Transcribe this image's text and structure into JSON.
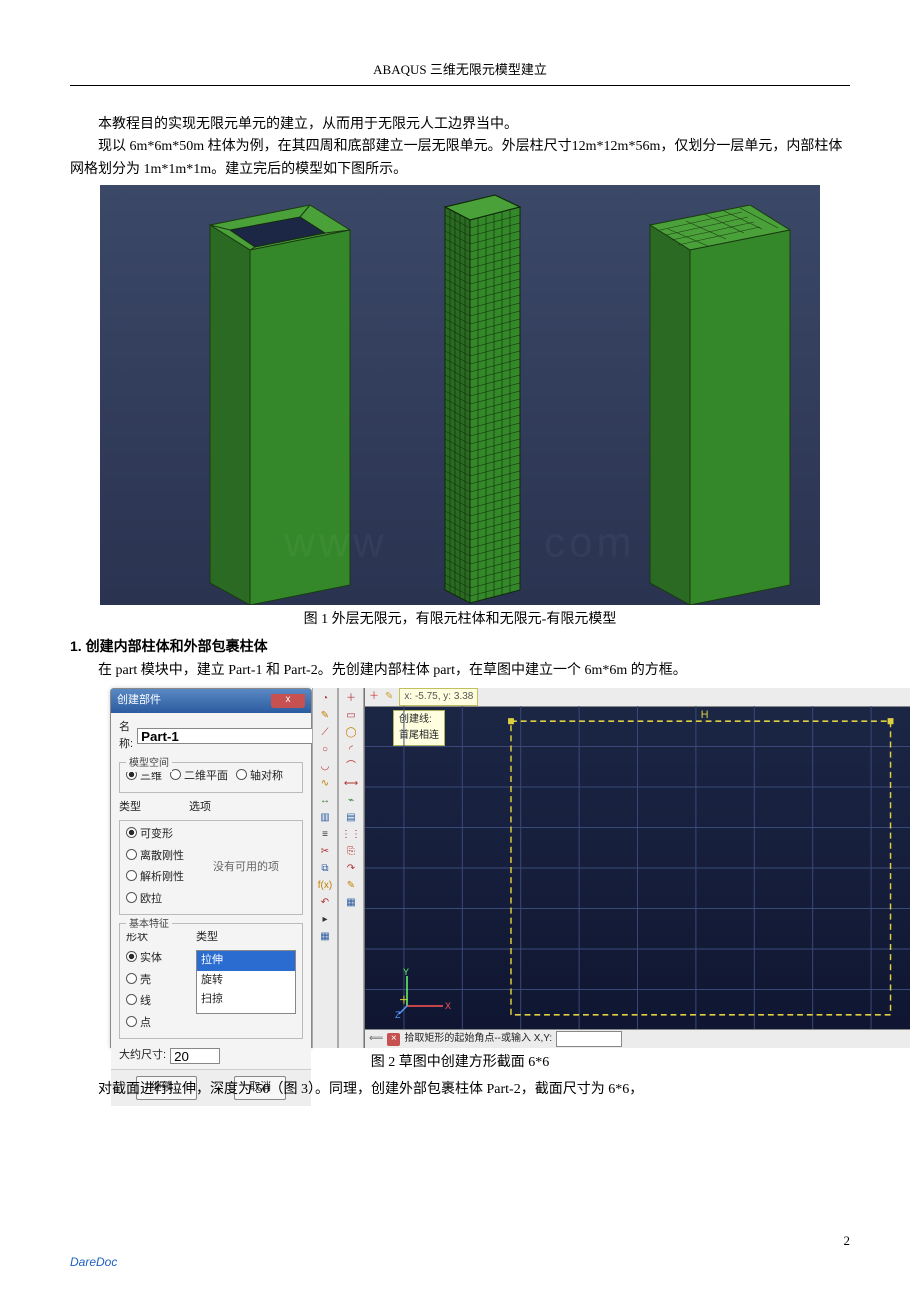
{
  "header": {
    "title": "ABAQUS 三维无限元模型建立"
  },
  "paragraphs": {
    "p1": "本教程目的实现无限元单元的建立，从而用于无限元人工边界当中。",
    "p2": "现以 6m*6m*50m 柱体为例，在其四周和底部建立一层无限单元。外层柱尺寸12m*12m*56m，仅划分一层单元，内部柱体网格划分为 1m*1m*1m。建立完后的模型如下图所示。",
    "fig1_caption": "图 1  外层无限元，有限元柱体和无限元-有限元模型",
    "section1": "1. 创建内部柱体和外部包裹柱体",
    "p3": "在 part 模块中，建立 Part-1 和 Part-2。先创建内部柱体 part，在草图中建立一个 6m*6m 的方框。",
    "fig2_caption": "图 2  草图中创建方形截面 6*6",
    "p4": "对截面进行拉伸，深度为 50（图 3）。同理，创建外部包裹柱体 Part-2，截面尺寸为 6*6，"
  },
  "dialog": {
    "title": "创建部件",
    "name_label": "名称:",
    "name_value": "Part-1",
    "space_group": "模型空间",
    "space_options": [
      "三维",
      "二维平面",
      "轴对称"
    ],
    "space_selected": 0,
    "type_label": "类型",
    "options_label": "选项",
    "type_options": [
      "可变形",
      "离散刚性",
      "解析刚性",
      "欧拉"
    ],
    "type_selected": 0,
    "options_placeholder": "没有可用的项",
    "base_feature_group": "基本特征",
    "shape_label": "形状",
    "shape_type_label": "类型",
    "shape_options": [
      "实体",
      "壳",
      "线",
      "点"
    ],
    "shape_selected": 0,
    "shape_types": [
      "拉伸",
      "旋转",
      "扫掠"
    ],
    "shape_type_selected": 0,
    "approx_size_label": "大约尺寸:",
    "approx_size_value": "20",
    "continue_btn": "继续...",
    "cancel_btn": "取消"
  },
  "sketch": {
    "coord_readout": "x: -5.75, y: 3.38",
    "tooltip": "创建线:\n首尾相连",
    "marker_H": "H",
    "prompt": "拾取矩形的起始角点--或输入 X,Y:",
    "axis_x": "X",
    "axis_y": "Y",
    "axis_z": "Z"
  },
  "footer": {
    "brand": "DareDoc",
    "page_number": "2"
  }
}
